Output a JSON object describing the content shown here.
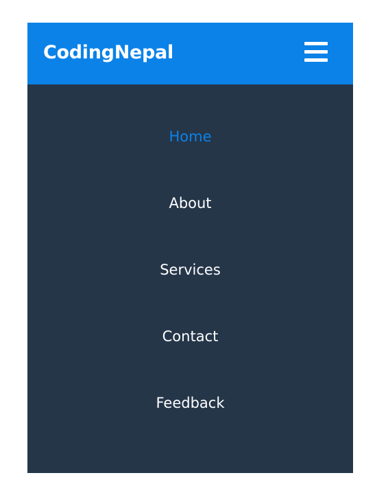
{
  "navbar": {
    "brand": "CodingNepal",
    "menu_icon": "hamburger-menu-icon",
    "background_color": "#0b82e8"
  },
  "menu": {
    "background_color": "#253649",
    "active_color": "#0b82e8",
    "items": [
      {
        "label": "Home",
        "active": true
      },
      {
        "label": "About",
        "active": false
      },
      {
        "label": "Services",
        "active": false
      },
      {
        "label": "Contact",
        "active": false
      },
      {
        "label": "Feedback",
        "active": false
      }
    ]
  }
}
